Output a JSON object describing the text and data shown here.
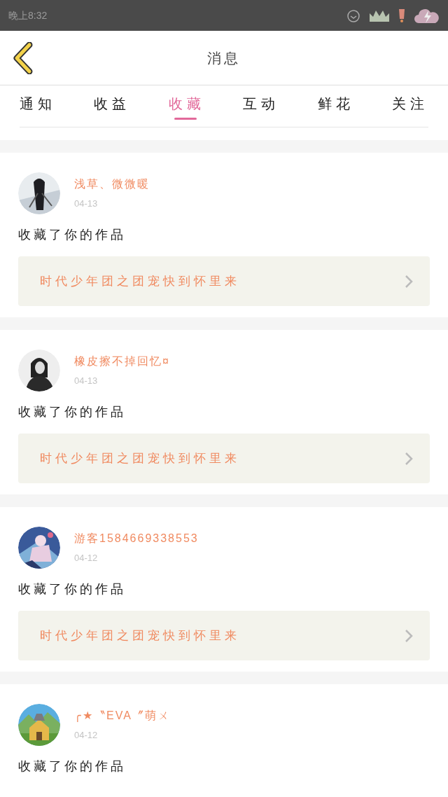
{
  "status_bar": {
    "time": "晚上8:32"
  },
  "header": {
    "title": "消息"
  },
  "tabs": [
    {
      "label": "通知",
      "selected": false
    },
    {
      "label": "收益",
      "selected": false
    },
    {
      "label": "收藏",
      "selected": true
    },
    {
      "label": "互动",
      "selected": false
    },
    {
      "label": "鲜花",
      "selected": false
    },
    {
      "label": "关注",
      "selected": false
    }
  ],
  "messages": [
    {
      "user": "浅草、微微暖",
      "date": "04-13",
      "text": "收藏了你的作品",
      "work": "时代少年团之团宠快到怀里来"
    },
    {
      "user": "橡皮擦不掉回忆¤",
      "date": "04-13",
      "text": "收藏了你的作品",
      "work": "时代少年团之团宠快到怀里来"
    },
    {
      "user": "游客1584669338553",
      "date": "04-12",
      "text": "收藏了你的作品",
      "work": "时代少年团之团宠快到怀里来"
    },
    {
      "user": "╭★〝EVA〞萌ㄨ",
      "date": "04-12",
      "text": "收藏了你的作品"
    }
  ]
}
